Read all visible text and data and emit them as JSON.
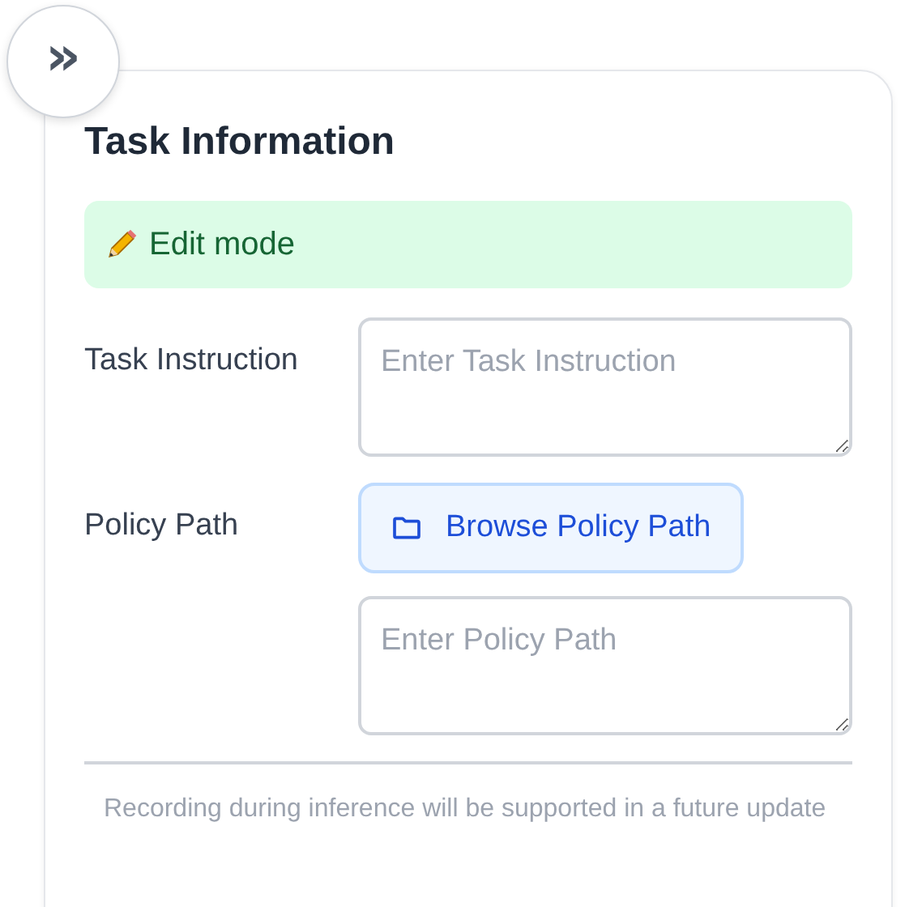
{
  "toggle": {
    "label": "»"
  },
  "card": {
    "title": "Task Information",
    "mode_banner": {
      "text": "Edit mode"
    },
    "fields": [
      {
        "kind": "textarea",
        "label": "Task Instruction",
        "placeholder": "Enter Task Instruction"
      },
      {
        "kind": "browse",
        "label": "Policy Path",
        "button": "Browse Policy Path",
        "placeholder": "Enter Policy Path"
      }
    ],
    "note": "Recording during inference will be supported in a future update"
  }
}
